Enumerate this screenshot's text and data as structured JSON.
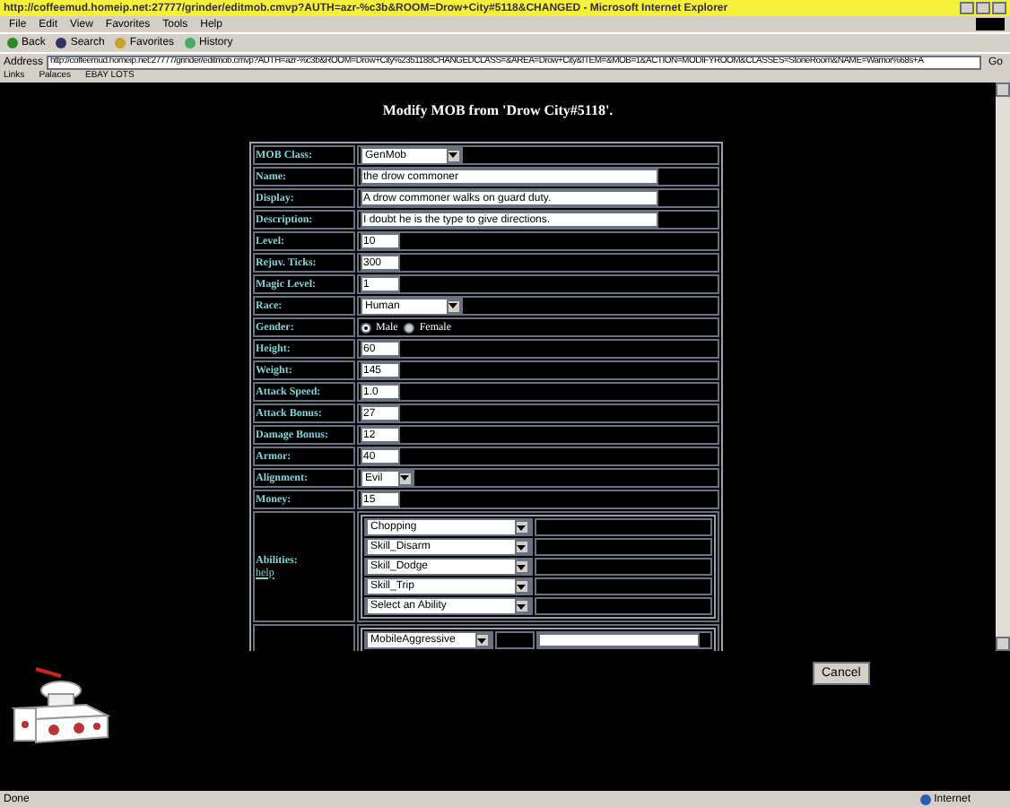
{
  "window": {
    "title": "http://coffeemud.homeip.net:27777/grinder/editmob.cmvp?AUTH=azr-%c3b&ROOM=Drow+City#5118&CHANGED - Microsoft Internet Explorer"
  },
  "menu": [
    "File",
    "Edit",
    "View",
    "Favorites",
    "Tools",
    "Help"
  ],
  "toolbar": [
    {
      "label": "Back",
      "kind": "back"
    },
    {
      "label": "Search",
      "kind": "search"
    },
    {
      "label": "Favorites",
      "kind": "favorites"
    },
    {
      "label": "History",
      "kind": "history"
    }
  ],
  "address": {
    "label": "Address",
    "value": "http://coffeemud.homeip.net:27777/grinder/editmob.cmvp?AUTH=azr-%c3b&ROOM=Drow+City%2351188CHANGEDCLASS=&AREA=Drow+City&ITEM=&MOB=1&ACTION=MODIFYROOM&CLASSES=StoneRoom&NAME=Warrior%68s+A",
    "go": "Go"
  },
  "links": [
    "Links",
    "Palaces",
    "EBAY LOTS"
  ],
  "page": {
    "heading": "Modify MOB from 'Drow City#5118'.",
    "fields": [
      {
        "label": "MOB Class:",
        "kind": "select",
        "value": "GenMob"
      },
      {
        "label": "Name:",
        "kind": "longtext",
        "value": "the drow commoner"
      },
      {
        "label": "Display:",
        "kind": "longtext",
        "value": "A drow commoner walks on guard duty."
      },
      {
        "label": "Description:",
        "kind": "longtext",
        "value": "I doubt he is the type to give directions."
      },
      {
        "label": "Level:",
        "kind": "text",
        "value": "10"
      },
      {
        "label": "Rejuv. Ticks:",
        "kind": "text",
        "value": "300"
      },
      {
        "label": "Magic Level:",
        "kind": "text",
        "value": "1"
      },
      {
        "label": "Race:",
        "kind": "select",
        "value": "Human"
      },
      {
        "label": "Gender:",
        "kind": "radio",
        "options": [
          {
            "label": "Male",
            "selected": true
          },
          {
            "label": "Female",
            "selected": false
          }
        ]
      },
      {
        "label": "Height:",
        "kind": "text",
        "value": "60"
      },
      {
        "label": "Weight:",
        "kind": "text",
        "value": "145"
      },
      {
        "label": "Attack Speed:",
        "kind": "text",
        "value": "1.0"
      },
      {
        "label": "Attack Bonus:",
        "kind": "text",
        "value": "27"
      },
      {
        "label": "Damage Bonus:",
        "kind": "text",
        "value": "12"
      },
      {
        "label": "Armor:",
        "kind": "text",
        "value": "40"
      },
      {
        "label": "Alignment:",
        "kind": "smallselect",
        "value": "Evil"
      },
      {
        "label": "Money:",
        "kind": "text",
        "value": "15"
      }
    ],
    "abilities": {
      "label": "Abilities:",
      "help": "help",
      "items": [
        "Chopping",
        "Skill_Disarm",
        "Skill_Dodge",
        "Skill_Trip",
        "Select an Ability"
      ]
    },
    "behaviors": [
      {
        "value": "MobileAggressive"
      }
    ],
    "cancel": "Cancel"
  },
  "status": {
    "text": "Done",
    "zone": "Internet"
  }
}
